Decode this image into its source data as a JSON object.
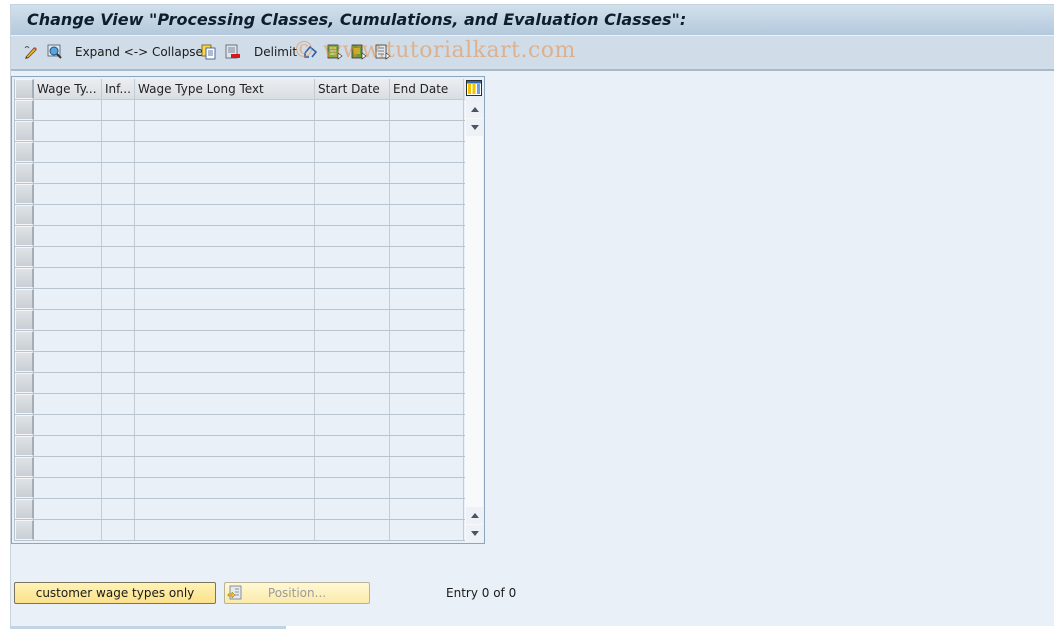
{
  "title": "Change View \"Processing Classes, Cumulations, and Evaluation Classes\":",
  "toolbar": {
    "items": [
      {
        "icon": "edit-pencil-icon"
      },
      {
        "icon": "display-search-icon"
      },
      {
        "label": "Expand <-> Collapse"
      },
      {
        "icon": "copy-icon"
      },
      {
        "icon": "delete-row-icon"
      },
      {
        "label": "Delimit"
      },
      {
        "icon": "undo-change-icon"
      },
      {
        "icon": "select-all-icon"
      },
      {
        "icon": "select-block-icon"
      },
      {
        "icon": "deselect-all-icon"
      }
    ],
    "expand_collapse_label": "Expand <-> Collapse",
    "delimit_label": "Delimit"
  },
  "watermark": "© www.tutorialkart.com",
  "table": {
    "columns": [
      "Wage Ty...",
      "Inf...",
      "Wage Type Long Text",
      "Start Date",
      "End Date"
    ],
    "row_count": 21,
    "rows": []
  },
  "buttons": {
    "customer_wage_types": "customer wage types only",
    "position": "Position..."
  },
  "entry_status": "Entry 0 of 0"
}
